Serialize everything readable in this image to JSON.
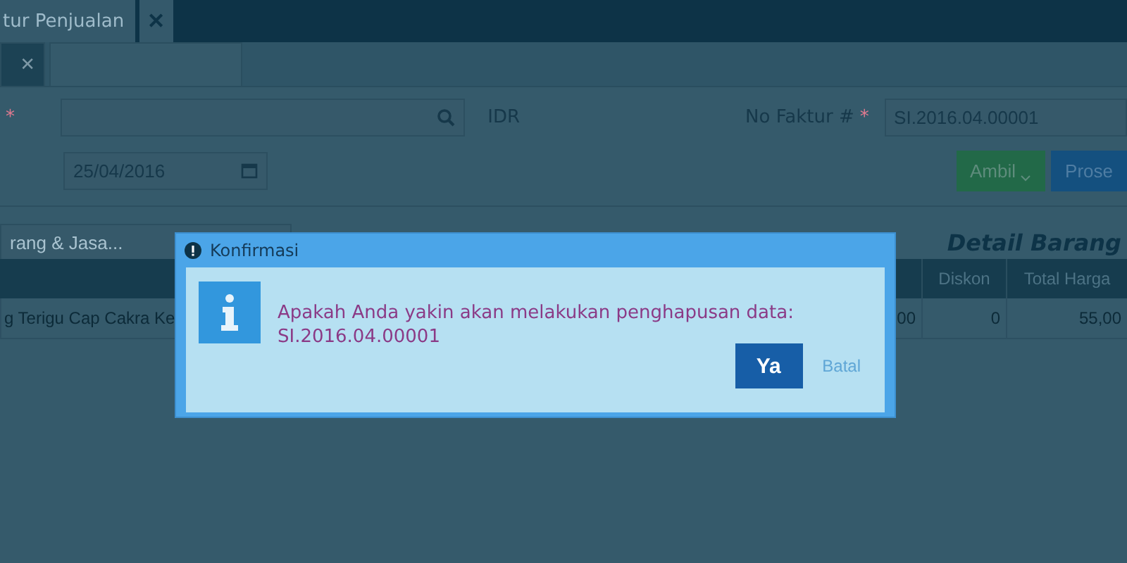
{
  "tabs": [
    {
      "label": "tur Penjualan",
      "selected": true,
      "close": "✕"
    }
  ],
  "subtabs": [
    {
      "close": "✕",
      "selected": false
    },
    {
      "selected": true
    }
  ],
  "form": {
    "required_mark": "*",
    "currency": "IDR",
    "invoice_label": "No Faktur #",
    "invoice_required": "*",
    "invoice_value": "SI.2016.04.00001",
    "date": "25/04/2016"
  },
  "buttons": [
    {
      "label": "Ambil",
      "kind": "dropdown"
    },
    {
      "label": "Prose",
      "kind": "primary"
    }
  ],
  "item_search": {
    "placeholder": "rang & Jasa..."
  },
  "detail_title": "Detail Barang",
  "table": {
    "columns": [
      "Diskon",
      "Total Harga"
    ],
    "rows": [
      {
        "name": "g Terigu Cap Cakra Ke",
        "column_1": "00",
        "discount": "0",
        "total": "55,00"
      }
    ]
  },
  "dialog": {
    "title": "Konfirmasi",
    "message": "Apakah Anda yakin akan melakukan penghapusan data:",
    "reference": "SI.2016.04.00001",
    "confirm": "Ya",
    "cancel": "Batal"
  }
}
